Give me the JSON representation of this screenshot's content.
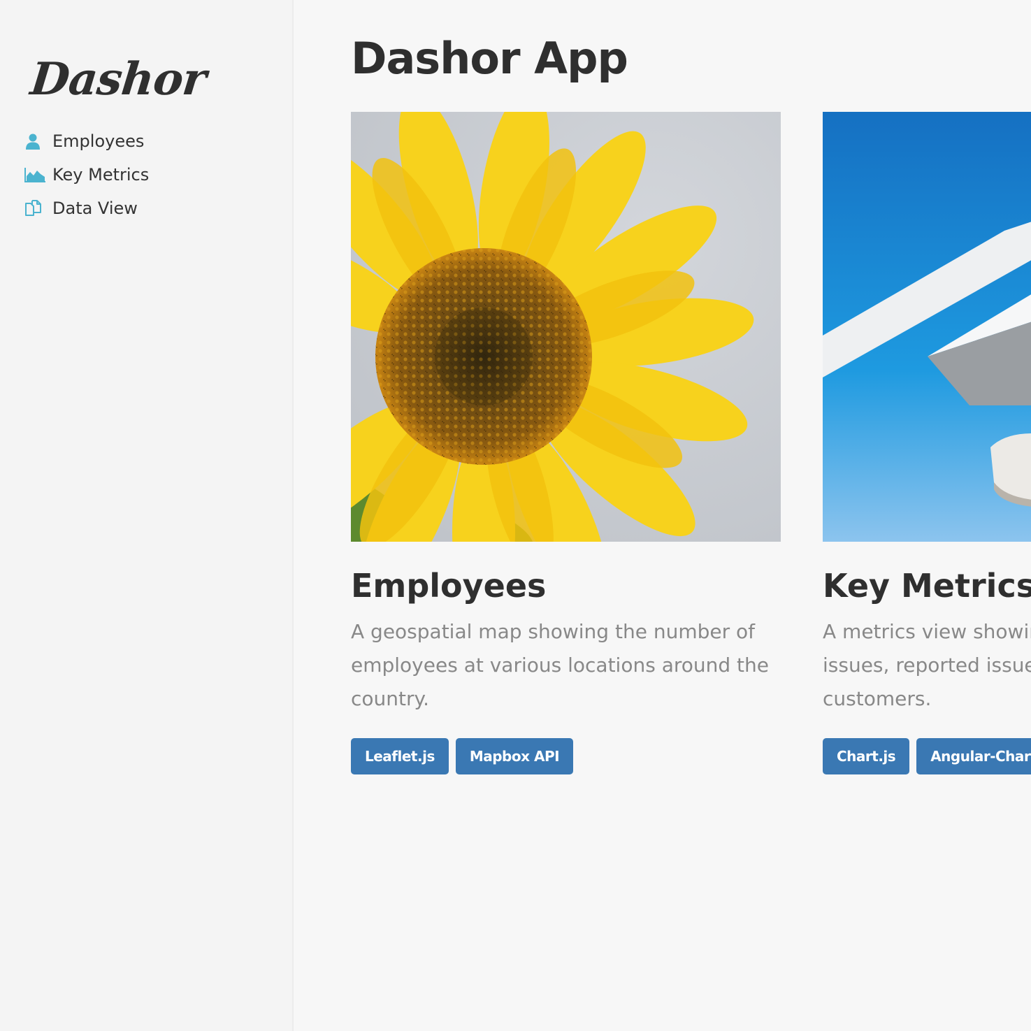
{
  "sidebar": {
    "logo": "Dashor",
    "items": [
      {
        "label": "Employees",
        "icon": "user-icon"
      },
      {
        "label": "Key Metrics",
        "icon": "area-chart-icon"
      },
      {
        "label": "Data View",
        "icon": "documents-icon"
      }
    ]
  },
  "main": {
    "title": "Dashor App",
    "cards": [
      {
        "title": "Employees",
        "description": "A geospatial map showing the number of employees at various locations around the country.",
        "image": "sunflower-photo",
        "tags": [
          "Leaflet.js",
          "Mapbox API"
        ]
      },
      {
        "title": "Key Metrics",
        "description_lines": [
          "A metrics view showir",
          "issues, reported issue",
          "customers."
        ],
        "image": "white-architecture-blue-sky-photo",
        "tags": [
          "Chart.js",
          "Angular-Chart"
        ]
      }
    ]
  },
  "colors": {
    "accent": "#4bb3cf",
    "tag_background": "#3a78b3",
    "heading": "#2f2f2f",
    "body_text": "#888888",
    "sidebar_background": "#f4f4f4",
    "main_background": "#f7f7f7"
  }
}
